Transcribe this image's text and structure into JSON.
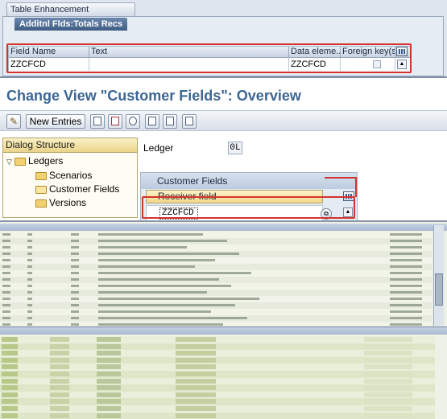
{
  "table_enhancement": {
    "window_title": "Table Enhancement",
    "tab_label": "Additnl Flds:Totals Recs",
    "columns": [
      "Field Name",
      "Text",
      "Data eleme...",
      "Foreign key(s)"
    ],
    "row": {
      "field_name": "ZZCFCD",
      "text": "",
      "data_element": "ZZCFCD"
    }
  },
  "change_view": {
    "title": "Change View \"Customer Fields\": Overview",
    "toolbar": {
      "new_entries_label": "New Entries"
    },
    "dialog_structure": {
      "header": "Dialog Structure",
      "items": [
        {
          "label": "Ledgers",
          "level": 0,
          "expanded": true
        },
        {
          "label": "Scenarios",
          "level": 1
        },
        {
          "label": "Customer Fields",
          "level": 1,
          "selected": true
        },
        {
          "label": "Versions",
          "level": 1
        }
      ]
    },
    "ledger": {
      "label": "Ledger",
      "value": "0L"
    },
    "customer_fields": {
      "header": "Customer Fields",
      "column": "Receiver field",
      "value": "ZZCFCD"
    }
  },
  "colors": {
    "highlight_red": "#d5322d",
    "title_blue": "#3d6693",
    "sap_tab_blue": "#3f5c84",
    "tree_header_gold": "#ead48a"
  }
}
